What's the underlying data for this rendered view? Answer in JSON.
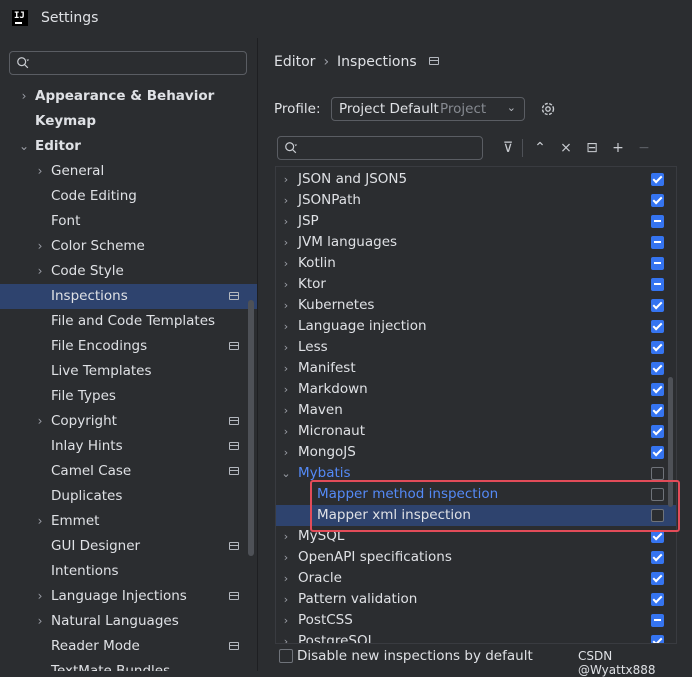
{
  "window": {
    "title": "Settings",
    "app_logo": "IJ"
  },
  "left": {
    "search": {
      "placeholder": ""
    },
    "tree": [
      {
        "label": "Appearance & Behavior",
        "level": 0,
        "chevron": "right",
        "bold": true
      },
      {
        "label": "Keymap",
        "level": 0,
        "chevron": "",
        "bold": true
      },
      {
        "label": "Editor",
        "level": 0,
        "chevron": "down",
        "bold": true
      },
      {
        "label": "General",
        "level": 1,
        "chevron": "right"
      },
      {
        "label": "Code Editing",
        "level": 1,
        "chevron": ""
      },
      {
        "label": "Font",
        "level": 1,
        "chevron": ""
      },
      {
        "label": "Color Scheme",
        "level": 1,
        "chevron": "right"
      },
      {
        "label": "Code Style",
        "level": 1,
        "chevron": "right"
      },
      {
        "label": "Inspections",
        "level": 1,
        "chevron": "",
        "badge": true,
        "selected": true
      },
      {
        "label": "File and Code Templates",
        "level": 1,
        "chevron": ""
      },
      {
        "label": "File Encodings",
        "level": 1,
        "chevron": "",
        "badge": true
      },
      {
        "label": "Live Templates",
        "level": 1,
        "chevron": ""
      },
      {
        "label": "File Types",
        "level": 1,
        "chevron": ""
      },
      {
        "label": "Copyright",
        "level": 1,
        "chevron": "right",
        "badge": true
      },
      {
        "label": "Inlay Hints",
        "level": 1,
        "chevron": "",
        "badge": true
      },
      {
        "label": "Camel Case",
        "level": 1,
        "chevron": "",
        "badge": true
      },
      {
        "label": "Duplicates",
        "level": 1,
        "chevron": ""
      },
      {
        "label": "Emmet",
        "level": 1,
        "chevron": "right"
      },
      {
        "label": "GUI Designer",
        "level": 1,
        "chevron": "",
        "badge": true
      },
      {
        "label": "Intentions",
        "level": 1,
        "chevron": ""
      },
      {
        "label": "Language Injections",
        "level": 1,
        "chevron": "right",
        "badge": true
      },
      {
        "label": "Natural Languages",
        "level": 1,
        "chevron": "right"
      },
      {
        "label": "Reader Mode",
        "level": 1,
        "chevron": "",
        "badge": true
      },
      {
        "label": "TextMate Bundles",
        "level": 1,
        "chevron": ""
      }
    ]
  },
  "right": {
    "breadcrumb": {
      "parent": "Editor",
      "separator": "›",
      "current": "Inspections"
    },
    "profile": {
      "label": "Profile:",
      "value": "Project Default",
      "tag": "Project",
      "dropdown": "⌄"
    },
    "search": {
      "placeholder": ""
    },
    "toolbar": [
      {
        "name": "filter-icon",
        "glyph": "⊽"
      },
      {
        "name": "expand-all-icon",
        "glyph": "⌃"
      },
      {
        "name": "collapse-all-icon",
        "glyph": "⨯"
      },
      {
        "name": "reset-icon",
        "glyph": "⊟"
      },
      {
        "name": "add-icon",
        "glyph": "+"
      },
      {
        "name": "remove-icon",
        "glyph": "−"
      }
    ],
    "inspections": [
      {
        "label": "JSON and JSON5",
        "state": "on"
      },
      {
        "label": "JSONPath",
        "state": "on"
      },
      {
        "label": "JSP",
        "state": "mixed"
      },
      {
        "label": "JVM languages",
        "state": "mixed"
      },
      {
        "label": "Kotlin",
        "state": "mixed"
      },
      {
        "label": "Ktor",
        "state": "mixed"
      },
      {
        "label": "Kubernetes",
        "state": "on"
      },
      {
        "label": "Language injection",
        "state": "on"
      },
      {
        "label": "Less",
        "state": "on"
      },
      {
        "label": "Manifest",
        "state": "on"
      },
      {
        "label": "Markdown",
        "state": "on"
      },
      {
        "label": "Maven",
        "state": "on"
      },
      {
        "label": "Micronaut",
        "state": "on"
      },
      {
        "label": "MongoJS",
        "state": "on"
      },
      {
        "label": "Mybatis",
        "state": "off",
        "expanded": true,
        "blue": true
      },
      {
        "label": "Mapper method inspection",
        "state": "off",
        "child": true,
        "blue": true
      },
      {
        "label": "Mapper xml inspection",
        "state": "off",
        "child": true,
        "selected": true
      },
      {
        "label": "MySQL",
        "state": "on"
      },
      {
        "label": "OpenAPI specifications",
        "state": "on"
      },
      {
        "label": "Oracle",
        "state": "on"
      },
      {
        "label": "Pattern validation",
        "state": "on"
      },
      {
        "label": "PostCSS",
        "state": "mixed"
      },
      {
        "label": "PostgreSQL",
        "state": "on"
      }
    ],
    "bottom": {
      "label": "Disable new inspections by default",
      "checked": false
    }
  },
  "watermark": "CSDN @Wyattx888",
  "colors": {
    "accent": "#3574f0",
    "selection": "#2e436e",
    "highlight_box": "#e34c59",
    "link_blue": "#548af7"
  }
}
